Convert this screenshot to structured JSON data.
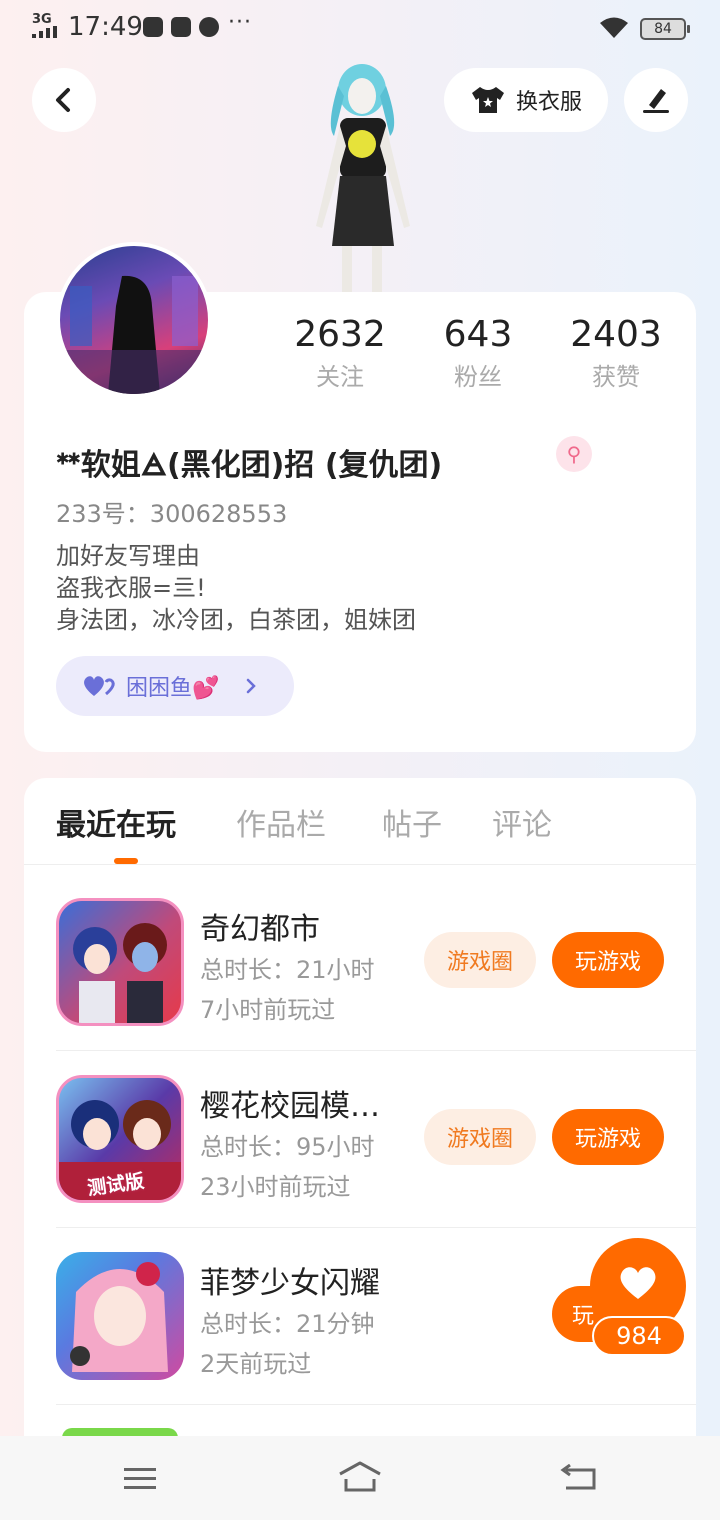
{
  "status_bar": {
    "network": "3G",
    "time": "17:49",
    "more": "···",
    "battery": "84"
  },
  "header": {
    "outfit_label": "换衣服"
  },
  "profile": {
    "stats": [
      {
        "num": "2632",
        "label": "关注"
      },
      {
        "num": "643",
        "label": "粉丝"
      },
      {
        "num": "2403",
        "label": "获赞"
      }
    ],
    "nickname": "ᕯ软姐🜁(黑化团)招 (复仇团)",
    "gender_icon": "⚲",
    "uid": "233号：300628553",
    "bio_lines": [
      "加好友写理由",
      "盗我衣服=亖!",
      "身法团，冰冷团，白茶团，姐妹团"
    ],
    "friend_chip": "困困鱼💕"
  },
  "tabs": [
    "最近在玩",
    "作品栏",
    "帖子",
    "评论"
  ],
  "games": [
    {
      "name": "奇幻都市",
      "duration": "总时长：21小时",
      "last_played": "7小时前玩过",
      "circle_btn": "游戏圈",
      "play_btn": "玩游戏"
    },
    {
      "name": "樱花校园模…",
      "duration": "总时长：95小时",
      "last_played": "23小时前玩过",
      "circle_btn": "游戏圈",
      "play_btn": "玩游戏",
      "badge": "测试版"
    },
    {
      "name": "菲梦少女闪耀",
      "duration": "总时长：21分钟",
      "last_played": "2天前玩过",
      "play_btn": "玩"
    }
  ],
  "like": {
    "count": "984"
  },
  "colors": {
    "accent": "#ff6a00",
    "accent_soft": "#fdeee3",
    "chip": "#ecebfb",
    "chip_text": "#6a6fd8"
  }
}
